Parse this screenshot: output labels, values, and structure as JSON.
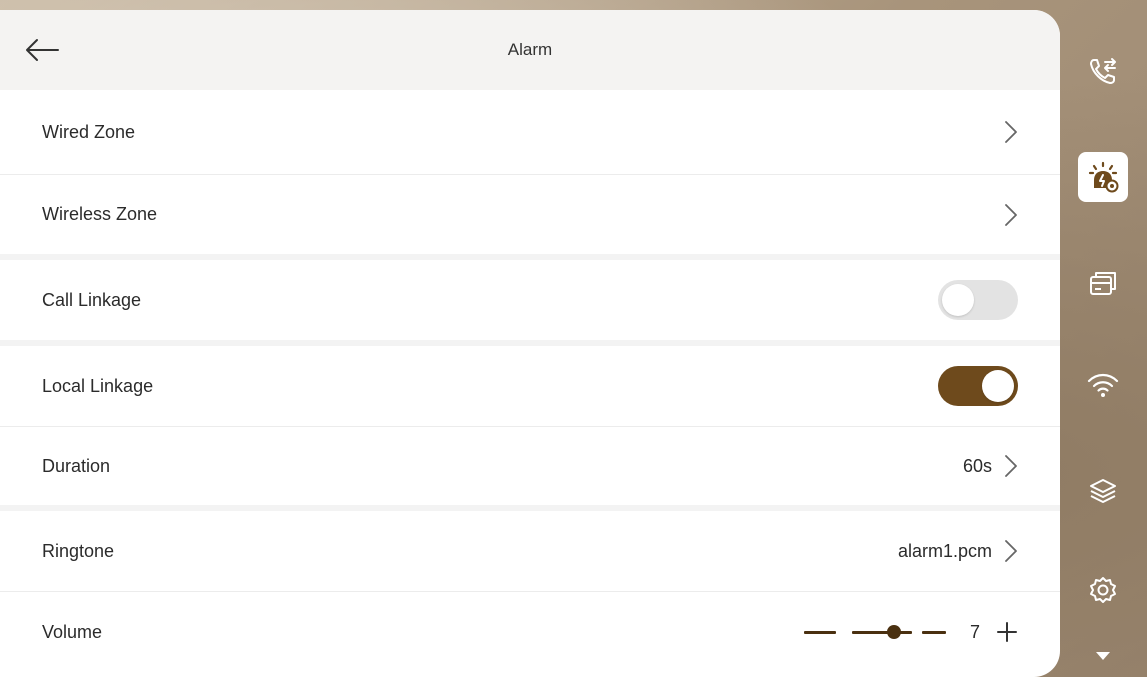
{
  "header": {
    "title": "Alarm",
    "back_icon": "arrow-left-icon"
  },
  "settings": {
    "wired_zone": {
      "label": "Wired Zone"
    },
    "wireless_zone": {
      "label": "Wireless Zone"
    },
    "call_linkage": {
      "label": "Call Linkage",
      "enabled": false
    },
    "local_linkage": {
      "label": "Local Linkage",
      "enabled": true
    },
    "duration": {
      "label": "Duration",
      "value": "60s"
    },
    "ringtone": {
      "label": "Ringtone",
      "value": "alarm1.pcm"
    },
    "volume": {
      "label": "Volume",
      "value": "7",
      "level_fraction": 0.7
    }
  },
  "sidebar": {
    "items": [
      {
        "icon": "call-transfer-icon",
        "active": false
      },
      {
        "icon": "alarm-settings-icon",
        "active": true
      },
      {
        "icon": "cards-icon",
        "active": false
      },
      {
        "icon": "wifi-icon",
        "active": false
      },
      {
        "icon": "layers-icon",
        "active": false
      },
      {
        "icon": "gear-icon",
        "active": false
      },
      {
        "icon": "chevron-down-icon",
        "active": false
      }
    ]
  },
  "colors": {
    "accent": "#6e4a1c",
    "slider": "#4a3010",
    "toggle_off": "#e3e3e3",
    "header_bg": "#f4f3f2",
    "sidebar_bg": "#b3a18a"
  }
}
